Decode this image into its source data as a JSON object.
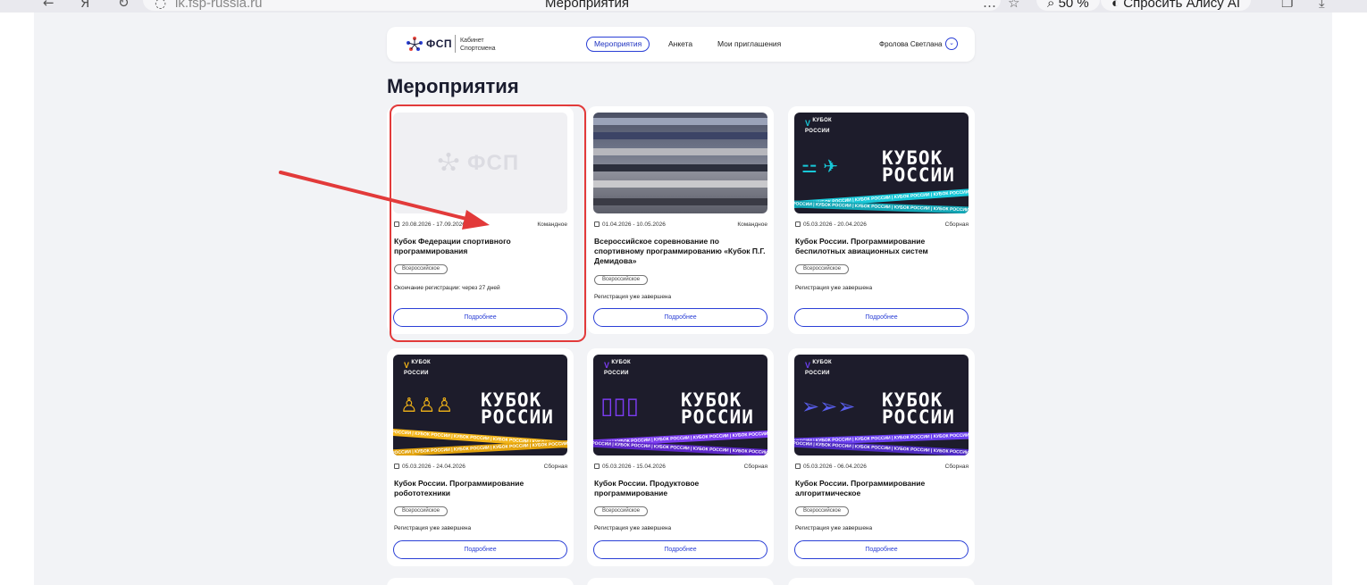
{
  "browser": {
    "url": "lk.fsp-russia.ru",
    "tab_title": "Мероприятия",
    "zoom": "50 %",
    "alice_button": "Спросить Алису AI"
  },
  "header": {
    "logo_text": "ФСП",
    "logo_sub_line1": "Кабинет",
    "logo_sub_line2": "Спортсмена",
    "nav": [
      {
        "label": "Мероприятия",
        "active": true
      },
      {
        "label": "Анкета",
        "active": false
      },
      {
        "label": "Мои приглашения",
        "active": false
      }
    ],
    "user_name": "Фролова Светлана"
  },
  "page": {
    "title": "Мероприятия"
  },
  "cards": [
    {
      "dates": "20.08.2026 - 17.09.2026",
      "type": "Командное",
      "title": "Кубок Федерации спортивного программирования",
      "tag": "Всероссийское",
      "status": "Окончание регистрации: через 27 дней",
      "button": "Подробнее",
      "image_text": "ФСП"
    },
    {
      "dates": "01.04.2026 - 10.05.2026",
      "type": "Командное",
      "title": "Всероссийское соревнование по спортивному программированию «Кубок П.Г. Демидова»",
      "tag": "Всероссийское",
      "status": "Регистрация уже завершена",
      "button": "Подробнее"
    },
    {
      "dates": "05.03.2026 - 20.04.2026",
      "type": "Сборная",
      "title": "Кубок России. Программирование беспилотных авиационных систем",
      "tag": "Всероссийское",
      "status": "Регистрация уже завершена",
      "button": "Подробнее",
      "accent": "#18c8d8"
    },
    {
      "dates": "05.03.2026 - 24.04.2026",
      "type": "Сборная",
      "title": "Кубок России. Программирование робототехники",
      "tag": "Всероссийское",
      "status": "Регистрация уже завершена",
      "button": "Подробнее",
      "accent": "#f2b418"
    },
    {
      "dates": "05.03.2026 - 15.04.2026",
      "type": "Сборная",
      "title": "Кубок России. Продуктовое программирование",
      "tag": "Всероссийское",
      "status": "Регистрация уже завершена",
      "button": "Подробнее",
      "accent": "#7b3cf0"
    },
    {
      "dates": "05.03.2026 - 06.04.2026",
      "type": "Сборная",
      "title": "Кубок России. Программирование алгоритмическое",
      "tag": "Всероссийское",
      "status": "Регистрация уже завершена",
      "button": "Подробнее",
      "accent": "#6a3ff0"
    }
  ],
  "kubok": {
    "logo_line1": "КУБОК",
    "logo_line2": "РОССИИ",
    "title_line1": "КУБОК",
    "title_line2": "РОССИИ",
    "ribbon": "КУБОК РОССИИ | КУБОК РОССИИ | КУБОК РОССИИ | КУБОК РОССИИ | КУБОК РОССИИ"
  },
  "colors": {
    "accent_blue": "#2a3fd6",
    "annotation_red": "#e23a3a",
    "page_bg": "#f2f3f6"
  }
}
